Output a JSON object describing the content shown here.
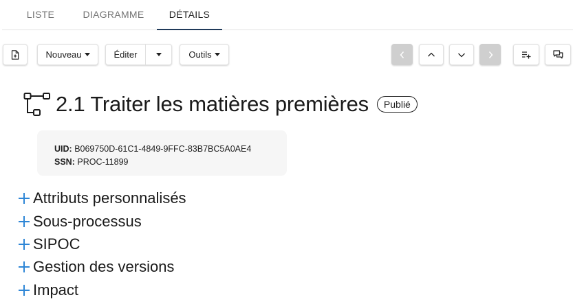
{
  "tabs": [
    {
      "label": "LISTE",
      "active": false
    },
    {
      "label": "DIAGRAMME",
      "active": false
    },
    {
      "label": "DÉTAILS",
      "active": true
    }
  ],
  "toolbar": {
    "document_icon": "file-document-icon",
    "nouveau_label": "Nouveau",
    "editer_label": "Éditer",
    "outils_label": "Outils",
    "prev_icon": "chevron-left-icon",
    "up_icon": "chevron-up-icon",
    "down_icon": "chevron-down-icon",
    "next_icon": "chevron-right-icon",
    "add_list_icon": "playlist-add-icon",
    "comment_icon": "comments-icon"
  },
  "process": {
    "icon": "process-tree-icon",
    "title": "2.1 Traiter les matières premières",
    "status": "Publié",
    "uid_label": "UID:",
    "uid_value": "B069750D-61C1-4849-9FFC-83B7BC5A0AE4",
    "ssn_label": "SSN:",
    "ssn_value": "PROC-11899"
  },
  "sections": [
    {
      "label": "Attributs personnalisés"
    },
    {
      "label": "Sous-processus"
    },
    {
      "label": "SIPOC"
    },
    {
      "label": "Gestion des versions"
    },
    {
      "label": "Impact"
    }
  ],
  "colors": {
    "accent_plus": "#2e86d6",
    "tab_indicator": "#1f3a5a",
    "disabled_button": "#cfcfcf",
    "card_background": "#f6f6f6"
  }
}
